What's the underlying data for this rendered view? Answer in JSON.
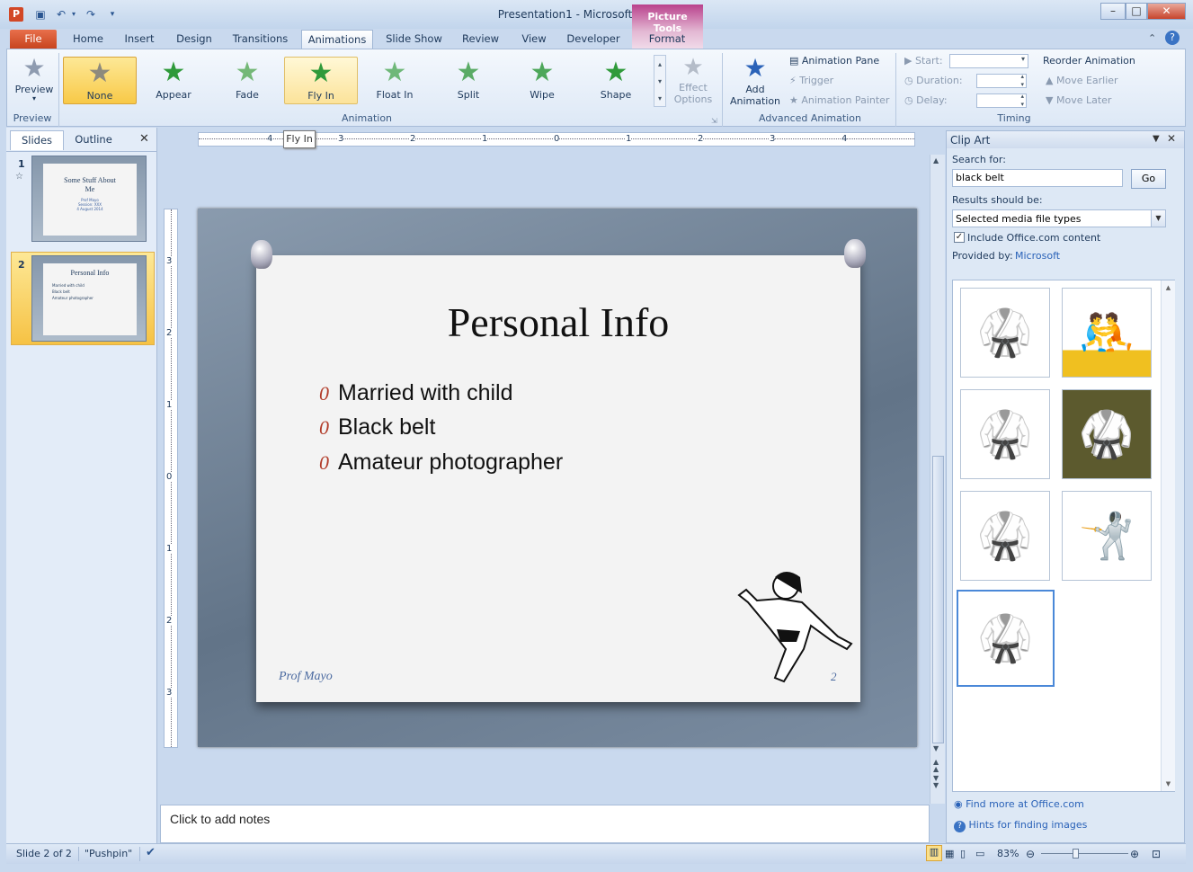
{
  "window": {
    "title": "Presentation1  -  Microsoft PowerPoint",
    "context_tab_group": "Picture Tools"
  },
  "tabs": [
    "File",
    "Home",
    "Insert",
    "Design",
    "Transitions",
    "Animations",
    "Slide Show",
    "Review",
    "View",
    "Developer",
    "Format"
  ],
  "ribbon": {
    "preview": {
      "button": "Preview",
      "group": "Preview"
    },
    "animation_gallery": {
      "items": [
        "None",
        "Appear",
        "Fade",
        "Fly In",
        "Float In",
        "Split",
        "Wipe",
        "Shape"
      ],
      "selected": "None",
      "hovered": "Fly In",
      "group": "Animation"
    },
    "effect_options": "Effect Options",
    "advanced": {
      "add_animation": "Add Animation",
      "pane": "Animation Pane",
      "trigger": "Trigger",
      "painter": "Animation Painter",
      "group": "Advanced Animation"
    },
    "timing": {
      "start": "Start:",
      "duration": "Duration:",
      "delay": "Delay:",
      "reorder": "Reorder Animation",
      "earlier": "Move Earlier",
      "later": "Move Later",
      "group": "Timing"
    }
  },
  "tooltip": "Fly In",
  "left_pane": {
    "tabs": [
      "Slides",
      "Outline"
    ],
    "slides": [
      {
        "num": "1",
        "title": "Some Stuff About Me",
        "sub": [
          "Prof Mayo",
          "Session: XXX",
          "4 August 2014"
        ]
      },
      {
        "num": "2",
        "title": "Personal Info",
        "bullets": [
          "Married with child",
          "Black belt",
          "Amateur photographer"
        ]
      }
    ]
  },
  "slide": {
    "title": "Personal Info",
    "bullets": [
      "Married with child",
      "Black belt",
      "Amateur photographer"
    ],
    "bullet_mark": "0",
    "footer": "Prof Mayo",
    "number": "2"
  },
  "ruler": {
    "h_ticks": [
      "4",
      "3",
      "2",
      "1",
      "0",
      "1",
      "2",
      "3",
      "4"
    ],
    "v_ticks": [
      "3",
      "2",
      "1",
      "0",
      "1",
      "2",
      "3"
    ]
  },
  "notes_placeholder": "Click to add notes",
  "clip_art": {
    "title": "Clip Art",
    "search_label": "Search for:",
    "search_value": "black belt",
    "go": "Go",
    "results_label": "Results should be:",
    "results_value": "Selected media file types",
    "include_label": "Include Office.com content",
    "include_checked": true,
    "provided_label": "Provided by:",
    "provider": "Microsoft",
    "find_more": "Find more at Office.com",
    "hints": "Hints for finding images"
  },
  "status": {
    "slide": "Slide 2 of 2",
    "theme": "\"Pushpin\"",
    "zoom": "83%"
  },
  "colors": {
    "accent_file": "#c6421d",
    "selected_gallery": "#f8c947",
    "context_tab": "#b9418c"
  }
}
